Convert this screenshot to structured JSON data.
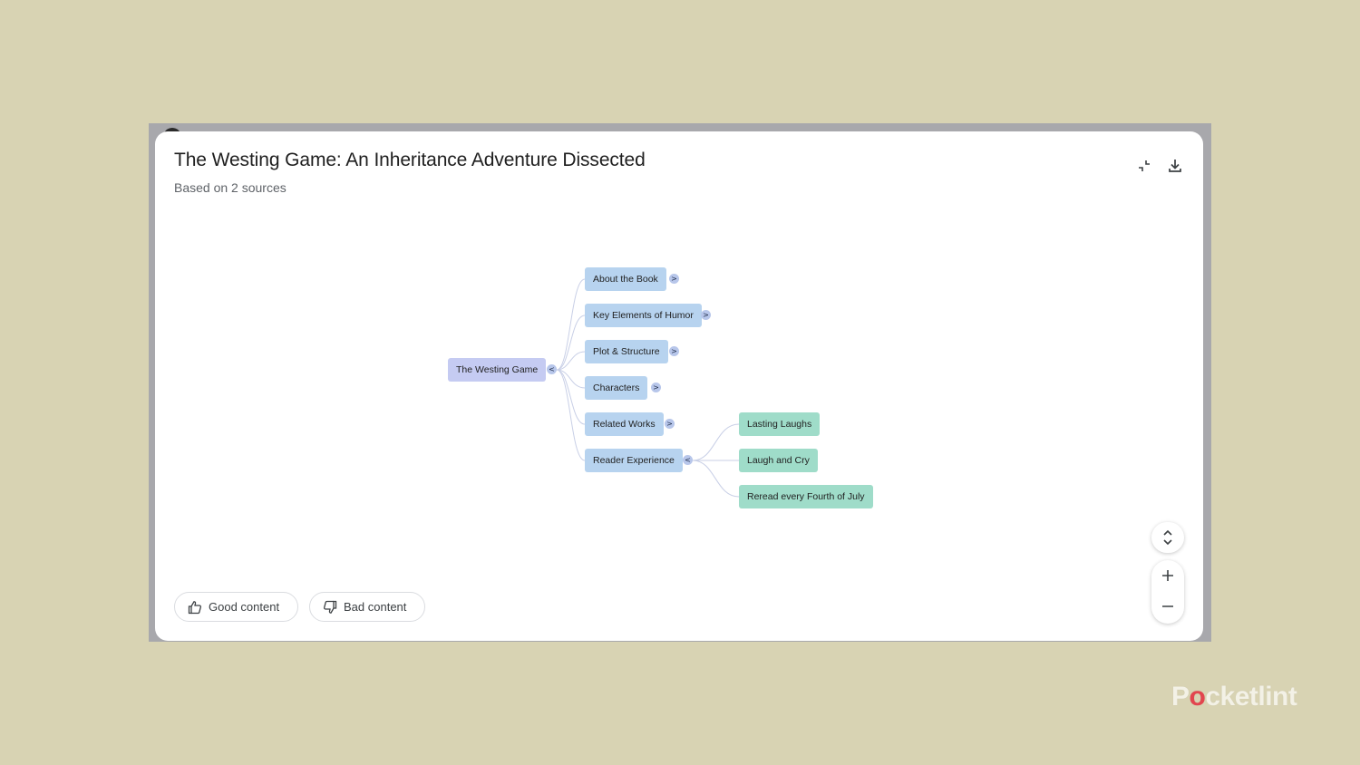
{
  "dialog": {
    "title": "The Westing Game: An Inheritance Adventure Dissected",
    "subtitle": "Based on 2 sources"
  },
  "icons": {
    "collapse": "collapse-fullscreen-icon",
    "download": "download-icon",
    "expand_collapse_all": "unfold-icon",
    "zoom_in": "plus-icon",
    "zoom_out": "minus-icon",
    "thumbs_up": "thumbs-up-icon",
    "thumbs_down": "thumbs-down-icon"
  },
  "mindmap": {
    "root": {
      "label": "The Westing Game",
      "toggle": "<"
    },
    "branches": [
      {
        "label": "About the Book",
        "toggle": ">"
      },
      {
        "label": "Key Elements of Humor",
        "toggle": ">"
      },
      {
        "label": "Plot & Structure",
        "toggle": ">"
      },
      {
        "label": "Characters",
        "toggle": ">"
      },
      {
        "label": "Related Works",
        "toggle": ">"
      },
      {
        "label": "Reader Experience",
        "toggle": "<",
        "children": [
          {
            "label": "Lasting Laughs"
          },
          {
            "label": "Laugh and Cry"
          },
          {
            "label": "Reread every Fourth of July"
          }
        ]
      }
    ]
  },
  "feedback": {
    "good_label": "Good content",
    "bad_label": "Bad content"
  },
  "watermark": {
    "brand_part1": "P",
    "brand_o": "o",
    "brand_part2": "cketlint"
  },
  "colors": {
    "background": "#d8d3b3",
    "root_node": "#c5cbf2",
    "branch_node": "#b7d3ef",
    "leaf_node": "#9fdcc9",
    "connector": "#c8cfe6"
  }
}
